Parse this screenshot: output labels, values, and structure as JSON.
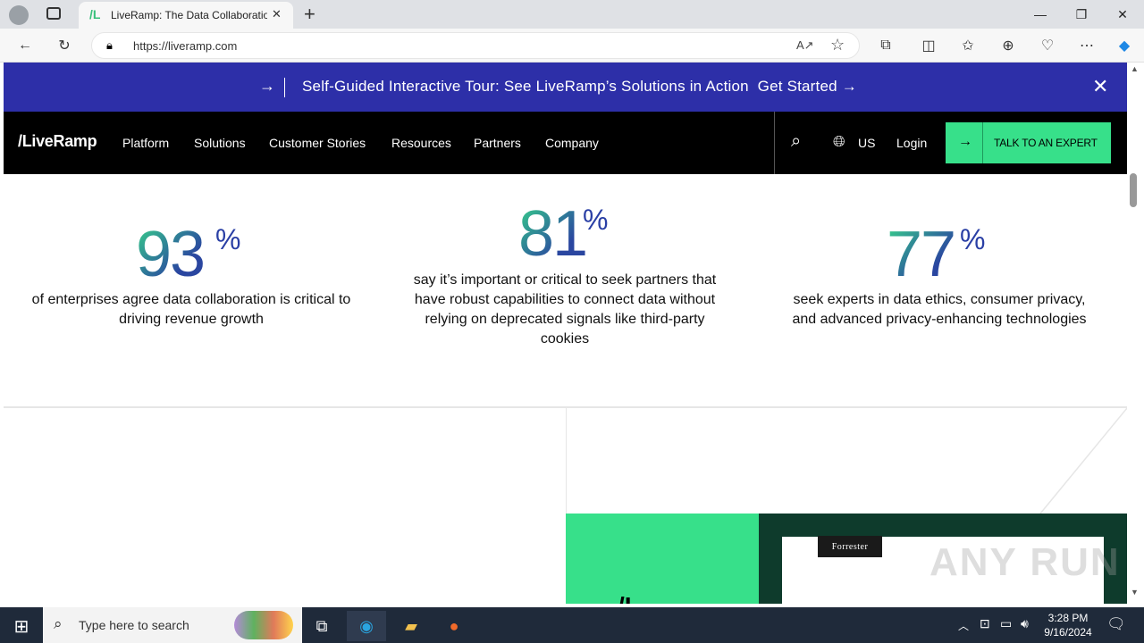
{
  "browser": {
    "tab_title": "LiveRamp: The Data Collaboration",
    "url": "https://liveramp.com",
    "new_tab": "+",
    "window_controls": [
      "—",
      "❐",
      "✕"
    ]
  },
  "banner": {
    "text": "Self-Guided Interactive Tour: See LiveRamp’s Solutions in Action",
    "cta": "Get Started →",
    "arrow": "→",
    "close": "✕"
  },
  "nav": {
    "logo": "/LiveRamp",
    "items": [
      "Platform",
      "Solutions",
      "Customer Stories",
      "Resources",
      "Partners",
      "Company"
    ],
    "region": "US",
    "login": "Login",
    "cta_label": "TALK TO AN EXPERT",
    "cta_arrow": "→"
  },
  "stats": [
    {
      "value": "93",
      "unit": "%",
      "desc": "of enterprises agree data collaboration is critical to driving revenue growth"
    },
    {
      "value": "81",
      "unit": "%",
      "desc": "say it’s important or critical to seek partners that have robust capabilities to connect data without relying on deprecated signals like third-party cookies"
    },
    {
      "value": "77",
      "unit": "%",
      "desc": "seek experts in data ethics, consumer privacy, and advanced privacy-enhancing technologies"
    }
  ],
  "card": {
    "badge": "Forrester"
  },
  "watermark": "ANY RUN",
  "taskbar": {
    "search_placeholder": "Type here to search",
    "time": "3:28 PM",
    "date": "9/16/2024"
  },
  "colors": {
    "banner_bg": "#2d2fa8",
    "accent_green": "#37e08a",
    "nav_bg": "#000000",
    "stat_blue": "#2a3fa5"
  }
}
